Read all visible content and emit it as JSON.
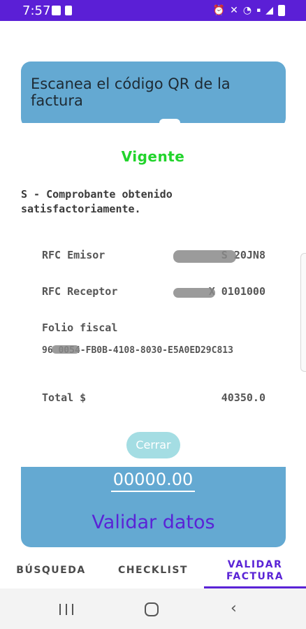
{
  "status_bar": {
    "time": "7:57",
    "left_icons": [
      "image-icon",
      "sd-card-icon"
    ],
    "right_icons": [
      "alarm-icon",
      "mute-icon",
      "wifi-icon",
      "volte-icon",
      "signal-icon",
      "battery-icon"
    ],
    "background": "#5b1fd6"
  },
  "scanner": {
    "title": "Escanea el código QR de la factura",
    "card_color": "#64a9d2"
  },
  "dialog": {
    "status": "Vigente",
    "status_color": "#22d42c",
    "message": "S - Comprobante obtenido satisfactoriamente.",
    "rfc_emisor_label": "RFC Emisor",
    "rfc_emisor_value": "S          20JN8",
    "rfc_receptor_label": "RFC Receptor",
    "rfc_receptor_value": "X           0101000",
    "folio_label": "Folio fiscal",
    "folio_value": "96    0054-FB0B-4108-8030-E5A0ED29C813",
    "total_label": "Total $",
    "total_value": "40350.0",
    "close_label": "Cerrar"
  },
  "validation": {
    "amount_value": "00000.00",
    "validate_label": "Validar datos",
    "accent": "#5a23d6"
  },
  "tabs": [
    {
      "label": "BÚSQUEDA",
      "active": false
    },
    {
      "label": "CHECKLIST",
      "active": false
    },
    {
      "label": "VALIDAR FACTURA",
      "active": true
    }
  ],
  "nav": {
    "recents": "recents-icon",
    "home": "home-icon",
    "back": "back-icon"
  }
}
